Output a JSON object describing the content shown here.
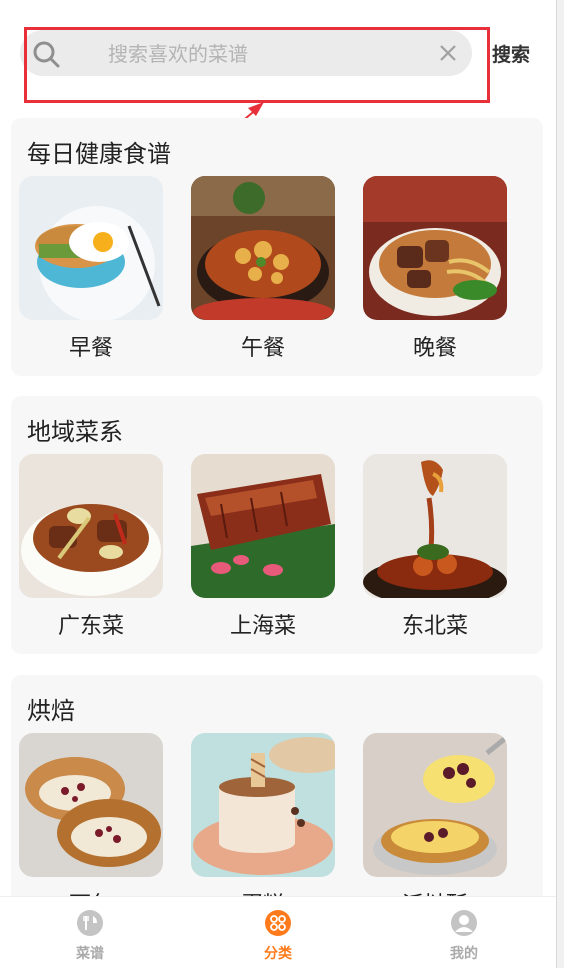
{
  "search": {
    "placeholder": "搜索喜欢的菜谱",
    "button_label": "搜索"
  },
  "sections": [
    {
      "title": "每日健康食谱",
      "items": [
        {
          "label": "早餐"
        },
        {
          "label": "午餐"
        },
        {
          "label": "晚餐"
        }
      ]
    },
    {
      "title": "地域菜系",
      "items": [
        {
          "label": "广东菜"
        },
        {
          "label": "上海菜"
        },
        {
          "label": "东北菜"
        }
      ]
    },
    {
      "title": "烘焙",
      "items": [
        {
          "label": "面包"
        },
        {
          "label": "蛋糕"
        },
        {
          "label": "派挞酥"
        }
      ]
    }
  ],
  "tabbar": {
    "tabs": [
      {
        "label": "菜谱",
        "icon": "cookbook-icon",
        "active": false
      },
      {
        "label": "分类",
        "icon": "category-icon",
        "active": true
      },
      {
        "label": "我的",
        "icon": "profile-icon",
        "active": false
      }
    ]
  },
  "colors": {
    "accent": "#ff7a1a",
    "highlight": "#e8303a",
    "section_bg": "#f7f7f7"
  }
}
